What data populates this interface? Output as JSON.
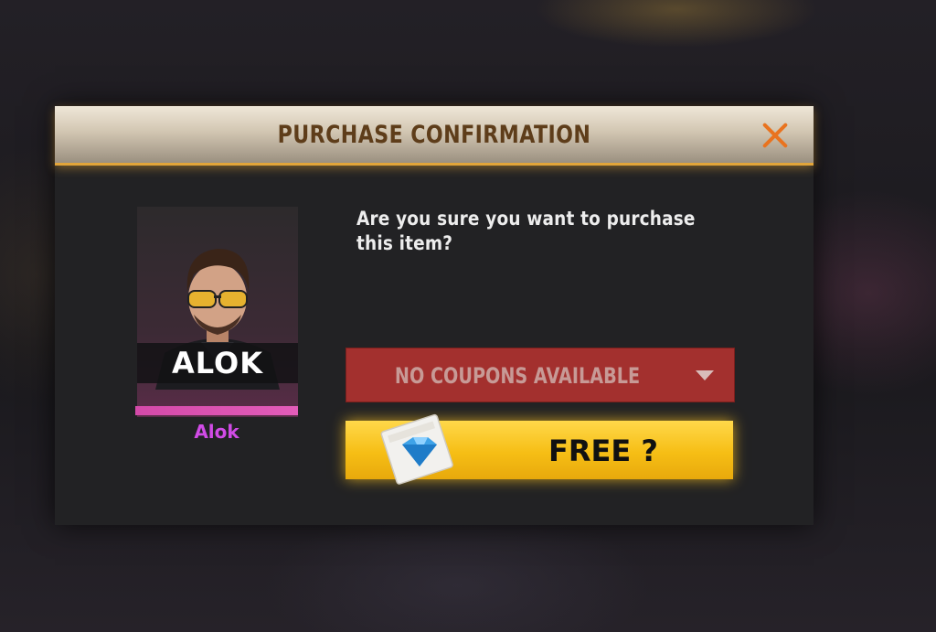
{
  "dialog": {
    "title": "PURCHASE CONFIRMATION",
    "close_icon": "close-x-icon",
    "accent_color": "#e9731f"
  },
  "character": {
    "logo_text": "ALOK",
    "name": "Alok",
    "name_color": "#d14be6"
  },
  "message": "Are you sure you want to purchase this item?",
  "coupon": {
    "selected": "NO COUPONS AVAILABLE",
    "icon": "chevron-down-icon"
  },
  "purchase_button": {
    "label": "FREE ?",
    "icon": "diamond-voucher-icon",
    "color": "#f6be15"
  }
}
